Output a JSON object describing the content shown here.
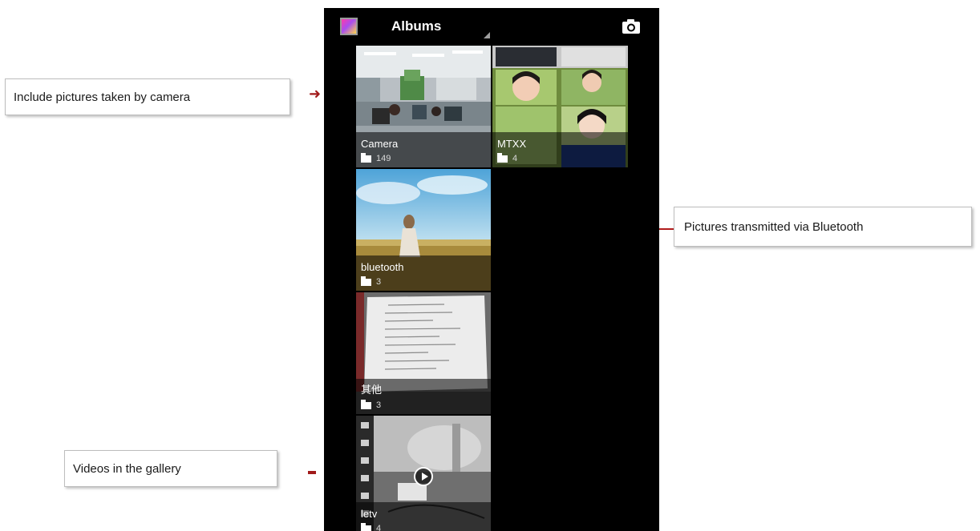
{
  "annotations": {
    "camera_note": "Include pictures taken by camera",
    "bluetooth_note": "Pictures transmitted via Bluetooth",
    "videos_note": "Videos in the gallery"
  },
  "action_bar": {
    "title": "Albums",
    "app_icon": "gallery-app-icon",
    "camera_icon": "camera-icon"
  },
  "albums": [
    {
      "name": "Camera",
      "count": "149"
    },
    {
      "name": "MTXX",
      "count": "4"
    },
    {
      "name": "bluetooth",
      "count": "3"
    },
    {
      "name": "其他",
      "count": "3"
    },
    {
      "name": "letv",
      "count": "4"
    }
  ],
  "colors": {
    "screen_background": "#000000",
    "annotation_pointer": "#a11a1a"
  }
}
